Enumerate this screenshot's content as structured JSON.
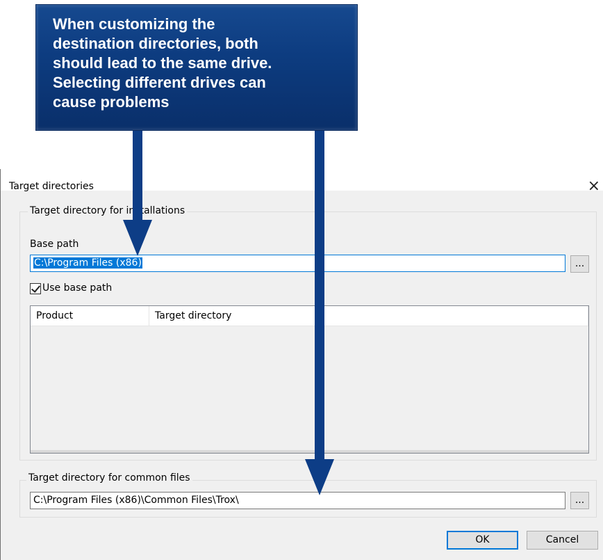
{
  "callout": {
    "lines": [
      "When customizing the",
      "destination directories, both",
      "should lead to the same drive.",
      "Selecting different drives can",
      "cause problems"
    ]
  },
  "dialog": {
    "title": "Target directories",
    "close_glyph": "×",
    "installations_group": {
      "legend": "Target directory for installations",
      "base_path_label": "Base path",
      "base_path_value": "C:\\Program Files (x86)",
      "browse_label": "...",
      "use_base_path_label": "Use base path",
      "use_base_path_checked": true,
      "table": {
        "columns": [
          "Product",
          "Target directory"
        ],
        "rows": []
      }
    },
    "common_files_group": {
      "legend": "Target directory for common files",
      "path_value": "C:\\Program Files (x86)\\Common Files\\Trox\\",
      "browse_label": "..."
    },
    "ok_label": "OK",
    "cancel_label": "Cancel"
  },
  "colors": {
    "callout_bg": "#0d3c80",
    "arrow": "#0d3d86",
    "selection": "#0078d7"
  }
}
